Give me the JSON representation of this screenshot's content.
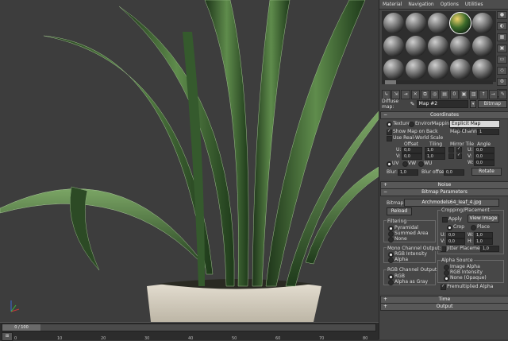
{
  "panel": {
    "menu": [
      "Material",
      "Navigation",
      "Options",
      "Utilities"
    ],
    "side_icons": [
      "sample-type-icon",
      "backlight-icon",
      "background-icon",
      "uv-tiling-icon",
      "video-check-icon",
      "make-preview-icon",
      "options-icon",
      "select-by-material-icon",
      "material-navigator-icon"
    ],
    "toolbar_icons": [
      "get-material-icon",
      "put-to-scene-icon",
      "assign-to-selection-icon",
      "reset-map-icon",
      "copy-material-icon",
      "make-unique-icon",
      "put-to-library-icon",
      "material-id-icon",
      "show-in-viewport-icon",
      "show-end-result-icon",
      "go-to-parent-icon",
      "go-forward-icon",
      "pick-from-object-icon"
    ],
    "diffuse_map_label": "Diffuse map:",
    "map_name": "Map #2",
    "map_type": "Bitmap",
    "coordinates": {
      "header": "Coordinates",
      "texture": "Texture",
      "environ": "Environ",
      "mapping_label": "Mapping:",
      "mapping_value": "Explicit Map Channel",
      "show_map_on_back": "Show Map on Back",
      "map_channel_label": "Map Channel:",
      "map_channel_value": "1",
      "use_real_world": "Use Real-World Scale",
      "offset": "Offset",
      "tiling": "Tiling",
      "mirror_tile": "Mirror Tile",
      "angle": "Angle",
      "u": "U:",
      "v": "V:",
      "w": "W:",
      "u_offset": "0,0",
      "v_offset": "0,0",
      "u_tiling": "1,0",
      "v_tiling": "1,0",
      "u_angle": "0,0",
      "v_angle": "0,0",
      "w_angle": "0,0",
      "uv": "UV",
      "vw": "VW",
      "wu": "WU",
      "blur_label": "Blur:",
      "blur_value": "1,0",
      "blur_offset_label": "Blur offset:",
      "blur_offset_value": "0,0",
      "rotate": "Rotate"
    },
    "noise_header": "Noise",
    "bitmap_params": {
      "header": "Bitmap Parameters",
      "bitmap_label": "Bitmap:",
      "bitmap_path": "Archmodels64_leaf_4.jpg",
      "reload": "Reload",
      "cropping_title": "Cropping/Placement",
      "apply": "Apply",
      "view_image": "View Image",
      "crop": "Crop",
      "place": "Place",
      "u_val": "0,0",
      "v_val": "0,0",
      "w_val": "1,0",
      "h_val": "1,0",
      "u": "U:",
      "v": "V:",
      "w": "W:",
      "h": "H:",
      "jitter": "Jitter Placement:",
      "jitter_val": "1,0",
      "filtering_title": "Filtering",
      "pyramidal": "Pyramidal",
      "summed_area": "Summed Area",
      "none": "None",
      "mono_title": "Mono Channel Output:",
      "rgb_intensity": "RGB Intensity",
      "alpha": "Alpha",
      "rgb_out_title": "RGB Channel Output:",
      "rgb": "RGB",
      "alpha_as_gray": "Alpha as Gray",
      "alpha_source_title": "Alpha Source",
      "image_alpha": "Image Alpha",
      "rgb_intensity2": "RGB Intensity",
      "none_opaque": "None (Opaque)",
      "premultiplied": "Premultiplied Alpha"
    },
    "time_header": "Time",
    "output_header": "Output"
  },
  "timeline": {
    "slider_label": "0 / 100",
    "ticks": [
      "0",
      "10",
      "20",
      "30",
      "40",
      "50",
      "60",
      "70",
      "80"
    ]
  },
  "colors": {
    "viewport_bg": "#3d3d3d",
    "leaf_dark": "#1f3a1c",
    "leaf_light": "#6f9a5a",
    "pot": "#d8d2c4"
  }
}
